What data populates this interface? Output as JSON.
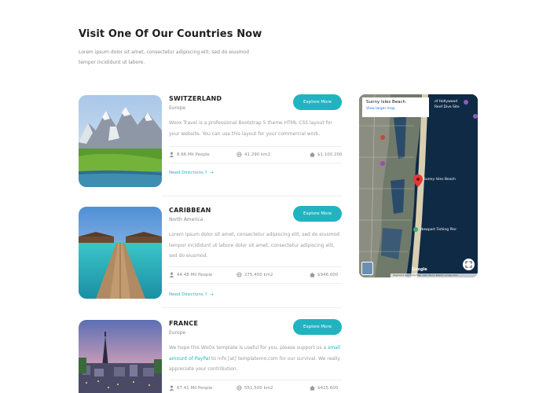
{
  "section": {
    "title": "Visit One Of Our Countries Now",
    "description": "Lorem ipsum dolor sit amet, consectetur adipiscing elit, sed do eiusmod tempor incididunt ut labore."
  },
  "cards": [
    {
      "name": "SWITZERLAND",
      "region": "Europe",
      "button": "Explore More",
      "description": "Woox Travel is a professional Bootstrap 5 theme HTML CSS layout for your website. You can use this layout for your commercial work.",
      "people": "8.66 Mil People",
      "area": "41.290 km2",
      "price": "$1.100.200",
      "directions": "Need Directions ?"
    },
    {
      "name": "CARIBBEAN",
      "region": "North America",
      "button": "Explore More",
      "description": "Lorem ipsum dolor sit amet, consectetur adipiscing elit, sed do eiusmod tempor incididunt ut labore dolor sit amet, consectetur adipiscing elit, sed do eiusmod.",
      "people": "44.48 Mil People",
      "area": "275.400 km2",
      "price": "$946.000",
      "directions": "Need Directions ?"
    },
    {
      "name": "FRANCE",
      "region": "Europe",
      "button": "Explore More",
      "description_before": "We hope this WoOx template is useful for you, please support us a ",
      "description_link": "small amount of PayPal",
      "description_after": " to info [at] templatemo.com for our survival. We really appreciate your contribution.",
      "people": "67.41 Mil People",
      "area": "551.500 km2",
      "price": "$425.600"
    }
  ],
  "map": {
    "place_title": "Sunny Isles Beach",
    "view_larger": "View larger map",
    "labels": {
      "sunny": "Sunny Isles Beach",
      "newport": "Newport Fishing Pier",
      "hollywood": "of Hollywood\nReef Dive Site"
    },
    "google": "Google",
    "footer": "Keyboard shortcuts  Map data  Terms  Report a map error"
  },
  "colors": {
    "accent": "#22b3c1"
  }
}
